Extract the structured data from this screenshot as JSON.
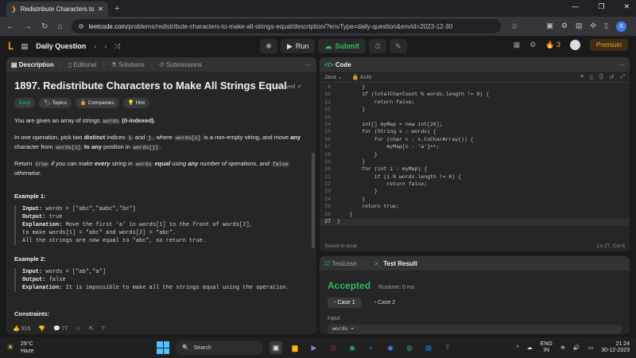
{
  "browser": {
    "tab_title": "Redistribute Characters to Ma",
    "url_host": "leetcode.com",
    "url_path": "/problems/redistribute-characters-to-make-all-strings-equal/description/?envType=daily-question&envId=2023-12-30"
  },
  "lc_nav": {
    "daily_question": "Daily Question",
    "run_label": "Run",
    "submit_label": "Submit",
    "streak": "3",
    "premium_label": "Premium"
  },
  "desc_panel": {
    "tabs": [
      "Description",
      "Editorial",
      "Solutions",
      "Submissions"
    ],
    "title": "1897. Redistribute Characters to Make All Strings Equal",
    "solved": "Solved",
    "tags": [
      "Easy",
      "Topics",
      "Companies",
      "Hint"
    ],
    "p1_a": "You are given an array of strings",
    "p1_code": "words",
    "p1_b": "(0-indexed).",
    "p2_a": "In one operation, pick two",
    "p2_distinct": "distinct",
    "p2_b": "indices",
    "p2_i": "i",
    "p2_and": "and",
    "p2_j": "j",
    "p2_c": ", where",
    "p2_wi": "words[i]",
    "p2_d": "is a non-empty string, and move",
    "p2_any": "any",
    "p2_e": "character from",
    "p2_wi2": "words[i]",
    "p2_to": "to",
    "p2_anypos": "any",
    "p2_f": "position in",
    "p2_wj": "words[j]",
    "p3_a": "Return",
    "p3_true": "true",
    "p3_b": "if you can make",
    "p3_every": "every",
    "p3_c": "string in",
    "p3_words": "words",
    "p3_equal": "equal",
    "p3_d": "using",
    "p3_any": "any",
    "p3_e": "number of operations, and",
    "p3_false": "false",
    "p3_f": "otherwise.",
    "ex1_title": "Example 1:",
    "ex1_input": "words = [\"abc\",\"aabc\",\"bc\"]",
    "ex1_output": "true",
    "ex1_expl1": "Move the first 'a' in words[1] to the front of words[2],",
    "ex1_expl2": "to make words[1] = \"abc\" and words[2] = \"abc\".",
    "ex1_expl3": "All the strings are now equal to \"abc\", so return true.",
    "ex2_title": "Example 2:",
    "ex2_input": "words = [\"ab\",\"a\"]",
    "ex2_output": "false",
    "ex2_expl": "It is impossible to make all the strings equal using the operation.",
    "constraints": "Constraints:",
    "likes": "916",
    "comments": "77",
    "lbl_input": "Input:",
    "lbl_output": "Output:",
    "lbl_expl": "Explanation:"
  },
  "code_panel": {
    "title": "Code",
    "language": "Java",
    "mode": "Auto",
    "saved": "Saved to local",
    "cursor": "Ln 27, Col 6",
    "lines": [
      {
        "n": "9",
        "t": "        }"
      },
      {
        "n": "10",
        "t": "        if (totalCharCount % words.length != 0) {"
      },
      {
        "n": "11",
        "t": "            return false;"
      },
      {
        "n": "12",
        "t": "        }"
      },
      {
        "n": "13",
        "t": ""
      },
      {
        "n": "14",
        "t": "        int[] myMap = new int[26];"
      },
      {
        "n": "15",
        "t": "        for (String s : words) {"
      },
      {
        "n": "16",
        "t": "            for (char c : s.toCharArray()) {"
      },
      {
        "n": "17",
        "t": "                myMap[c - 'a']++;"
      },
      {
        "n": "18",
        "t": "            }"
      },
      {
        "n": "19",
        "t": "        }"
      },
      {
        "n": "20",
        "t": "        for (int i : myMap) {"
      },
      {
        "n": "21",
        "t": "            if (i % words.length != 0) {"
      },
      {
        "n": "22",
        "t": "                return false;"
      },
      {
        "n": "23",
        "t": "            }"
      },
      {
        "n": "24",
        "t": "        }"
      },
      {
        "n": "25",
        "t": "        return true;"
      },
      {
        "n": "26",
        "t": "    }"
      },
      {
        "n": "27",
        "t": "}"
      }
    ]
  },
  "result_panel": {
    "tab_testcase": "Testcase",
    "tab_result": "Test Result",
    "status": "Accepted",
    "runtime": "Runtime: 0 ms",
    "case1": "Case 1",
    "case2": "Case 2",
    "input_label": "Input",
    "input_value": "words ="
  },
  "taskbar": {
    "temp": "29°C",
    "weather": "Haze",
    "search": "Search",
    "lang1": "ENG",
    "lang2": "IN",
    "time": "21:24",
    "date": "30-12-2023"
  },
  "colors": {
    "accent": "#ffa116",
    "accepted": "#2cbb5d",
    "easy": "#00b8a3"
  }
}
